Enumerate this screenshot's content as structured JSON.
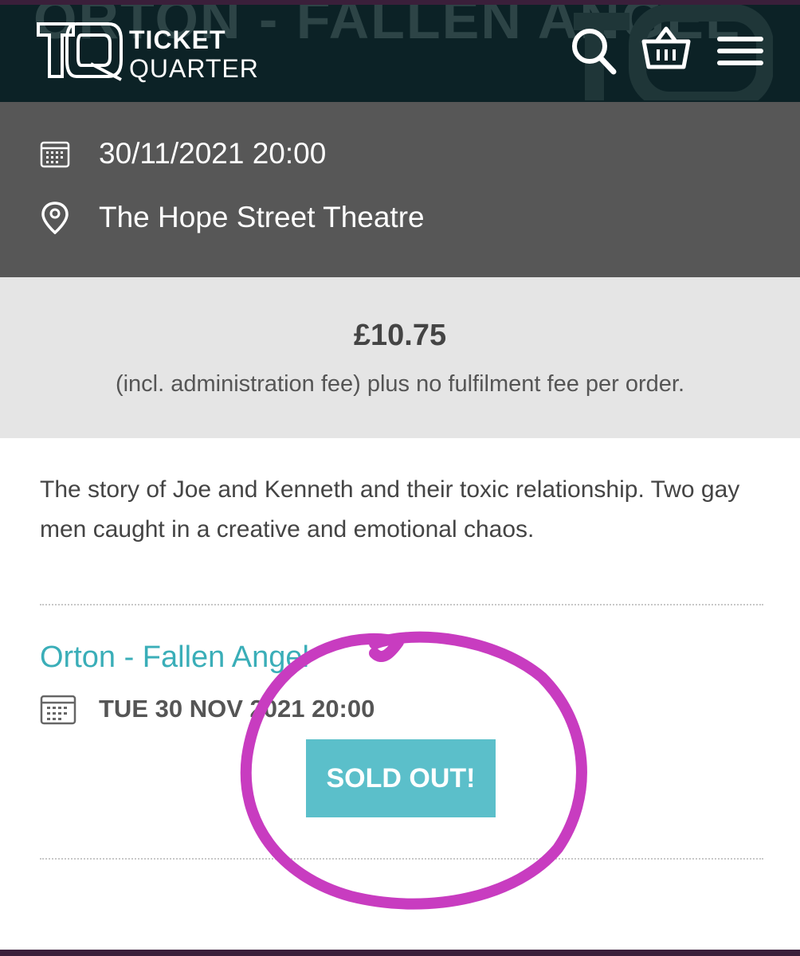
{
  "header": {
    "background_title": "ORTON - FALLEN ANGEL",
    "logo_line1": "TICKET",
    "logo_line2": "QUARTER",
    "icons": [
      "search-icon",
      "basket-icon",
      "hamburger-menu-icon"
    ],
    "colors": {
      "background": "#0c2226"
    }
  },
  "info": {
    "date_time": "30/11/2021 20:00",
    "venue": "The Hope Street Theatre",
    "icons": [
      "calendar-icon",
      "location-pin-icon"
    ]
  },
  "price": {
    "amount": "£10.75",
    "note": "(incl. administration fee) plus no fulfilment fee per order."
  },
  "description": "The story of Joe and Kenneth and their toxic relationship. Two gay men caught in a creative and emotional chaos.",
  "event": {
    "title": "Orton - Fallen Angel",
    "date": "TUE 30 NOV 2021 20:00",
    "status_button": "SOLD OUT!"
  },
  "colors": {
    "accent": "#3aaeb8",
    "button": "#5bbfca",
    "annotation_circle": "#c83cc0"
  }
}
